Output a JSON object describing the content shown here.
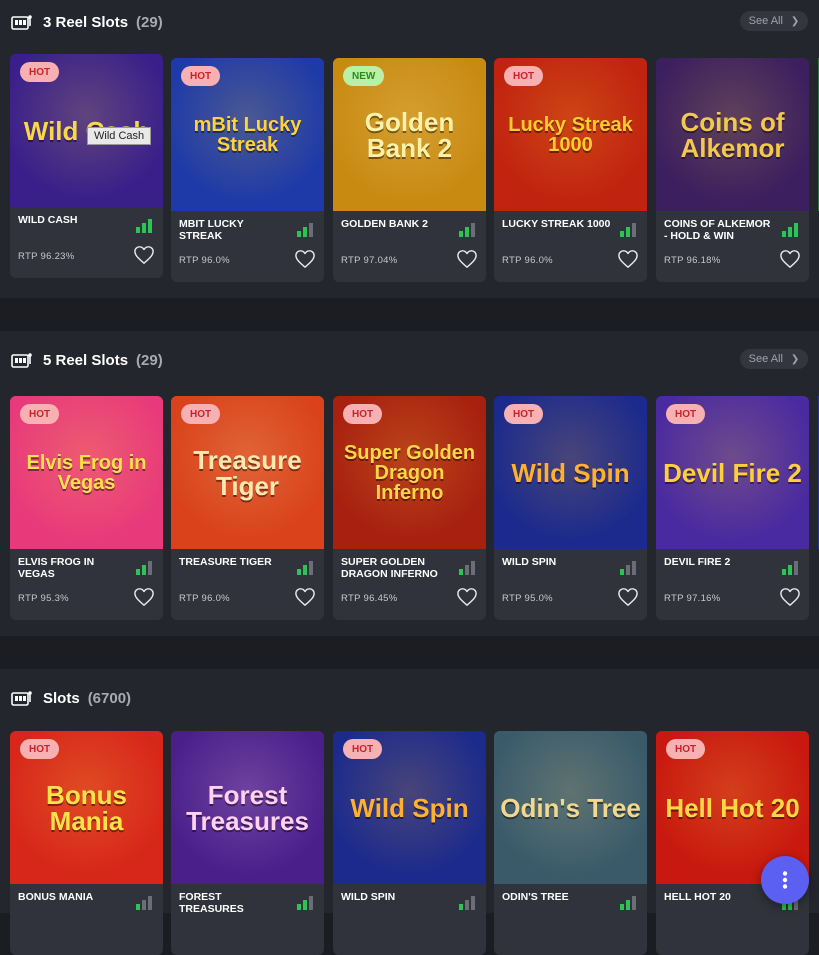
{
  "see_all_label": "See All",
  "tooltip": "Wild Cash",
  "sections": [
    {
      "title": "3 Reel Slots",
      "count": "(29)",
      "cards": [
        {
          "name": "WILD CASH",
          "rtp": "RTP 96.23%",
          "badge": "HOT",
          "art": "Wild Cash",
          "bg": "#3a1f8a",
          "fg": "#f8d84a",
          "volatility": 3
        },
        {
          "name": "MBIT LUCKY STREAK",
          "rtp": "RTP 96.0%",
          "badge": "HOT",
          "art": "mBit Lucky Streak",
          "bg": "#1e3aa8",
          "fg": "#ffd23a",
          "volatility": 2
        },
        {
          "name": "GOLDEN BANK 2",
          "rtp": "RTP 97.04%",
          "badge": "NEW",
          "art": "Golden Bank 2",
          "bg": "#c98a12",
          "fg": "#fff1a8",
          "volatility": 2
        },
        {
          "name": "LUCKY STREAK 1000",
          "rtp": "RTP 96.0%",
          "badge": "HOT",
          "art": "Lucky Streak 1000",
          "bg": "#c0230f",
          "fg": "#ffcc30",
          "volatility": 2
        },
        {
          "name": "COINS OF ALKEMOR - HOLD & WIN",
          "rtp": "RTP 96.18%",
          "badge": "",
          "art": "Coins of Alkemor",
          "bg": "#3c1f5e",
          "fg": "#f2c94c",
          "volatility": 3
        }
      ]
    },
    {
      "title": "5 Reel Slots",
      "count": "(29)",
      "cards": [
        {
          "name": "ELVIS FROG IN VEGAS",
          "rtp": "RTP 95.3%",
          "badge": "HOT",
          "art": "Elvis Frog in Vegas",
          "bg": "#e83a7a",
          "fg": "#ffe14a",
          "volatility": 2
        },
        {
          "name": "TREASURE TIGER",
          "rtp": "RTP 96.0%",
          "badge": "HOT",
          "art": "Treasure Tiger",
          "bg": "#d9421a",
          "fg": "#ffe9b0",
          "volatility": 2
        },
        {
          "name": "SUPER GOLDEN DRAGON INFERNO",
          "rtp": "RTP 96.45%",
          "badge": "HOT",
          "art": "Super Golden Dragon Inferno",
          "bg": "#a8200f",
          "fg": "#ffd54a",
          "volatility": 1
        },
        {
          "name": "WILD SPIN",
          "rtp": "RTP 95.0%",
          "badge": "HOT",
          "art": "Wild Spin",
          "bg": "#1b2a8c",
          "fg": "#ffb02e",
          "volatility": 1
        },
        {
          "name": "DEVIL FIRE 2",
          "rtp": "RTP 97.16%",
          "badge": "HOT",
          "art": "Devil Fire 2",
          "bg": "#4a2aa0",
          "fg": "#ffcf3a",
          "volatility": 2
        }
      ]
    },
    {
      "title": "Slots",
      "count": "(6700)",
      "cards": [
        {
          "name": "BONUS MANIA",
          "rtp": "",
          "badge": "HOT",
          "art": "Bonus Mania",
          "bg": "#d7261a",
          "fg": "#ffe24a",
          "volatility": 1
        },
        {
          "name": "FOREST TREASURES",
          "rtp": "",
          "badge": "",
          "art": "Forest Treasures",
          "bg": "#4a1f8a",
          "fg": "#ffd0f0",
          "volatility": 2
        },
        {
          "name": "WILD SPIN",
          "rtp": "",
          "badge": "HOT",
          "art": "Wild Spin",
          "bg": "#1b2a8c",
          "fg": "#ffb02e",
          "volatility": 1
        },
        {
          "name": "ODIN'S TREE",
          "rtp": "",
          "badge": "",
          "art": "Odin's Tree",
          "bg": "#3a5a6a",
          "fg": "#f0d890",
          "volatility": 2
        },
        {
          "name": "HELL HOT 20",
          "rtp": "",
          "badge": "HOT",
          "art": "Hell Hot 20",
          "bg": "#c8180f",
          "fg": "#ffd84a",
          "volatility": 2
        }
      ]
    }
  ],
  "colors": {
    "vol_on": "#2ec455",
    "vol_off": "#6b6e77",
    "fab": "#5b5ff2"
  }
}
